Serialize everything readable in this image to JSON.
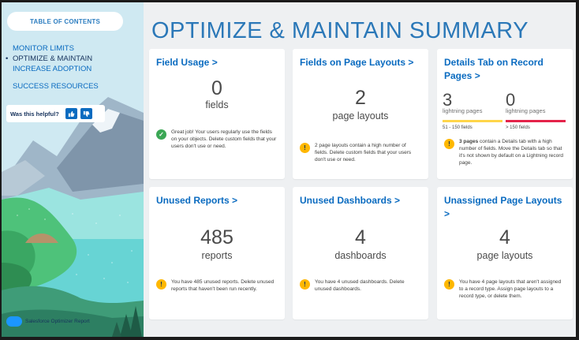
{
  "sidebar": {
    "toc_label": "TABLE OF CONTENTS",
    "nav": [
      {
        "label": "MONITOR LIMITS"
      },
      {
        "label": "OPTIMIZE & MAINTAIN"
      },
      {
        "label": "INCREASE ADOPTION"
      },
      {
        "label": "SUCCESS RESOURCES"
      }
    ],
    "helpful_label": "Was this helpful?",
    "brand_label": "Salesforce Optimizer Report"
  },
  "page_title": "OPTIMIZE & MAINTAIN SUMMARY",
  "cards": {
    "field_usage": {
      "title": "Field Usage >",
      "value": "0",
      "unit": "fields",
      "message": "Great job! Your users regularly use the fields on your objects. Delete custom fields that your users don't use or need.",
      "status": "ok"
    },
    "fields_layouts": {
      "title": "Fields on Page Layouts >",
      "value": "2",
      "unit": "page layouts",
      "message": "2 page layouts contain a high number of fields. Delete custom fields that your users don't use or need.",
      "status": "warning"
    },
    "details_tab": {
      "title": "Details Tab on Record Pages >",
      "left_value": "3",
      "left_label": "lightning pages",
      "left_range": "51 - 150 fields",
      "right_value": "0",
      "right_label": "lightning pages",
      "right_range": "> 150 fields",
      "message_bold": "3 pages",
      "message_rest": " contain a Details tab with a high number of fields. Move the Details tab so that it's not shown by default on a Lightning record page.",
      "status": "warning"
    },
    "unused_reports": {
      "title": "Unused Reports >",
      "value": "485",
      "unit": "reports",
      "message": "You have 485 unused reports. Delete unused reports that haven't been run recently.",
      "status": "warning"
    },
    "unused_dashboards": {
      "title": "Unused Dashboards >",
      "value": "4",
      "unit": "dashboards",
      "message": "You have 4 unused dashboards. Delete unused dashboards.",
      "status": "warning"
    },
    "unassigned_layouts": {
      "title": "Unassigned Page Layouts >",
      "value": "4",
      "unit": "page layouts",
      "message": "You have 4 page layouts that aren't assigned to a record type. Assign page layouts to a record type, or delete them.",
      "status": "warning"
    }
  },
  "colors": {
    "accent": "#0a6bc0",
    "title": "#2b78b8",
    "ok": "#3ba755",
    "warning": "#ffb700",
    "bar_yellow": "#ffd54a",
    "bar_red": "#e4234a"
  }
}
